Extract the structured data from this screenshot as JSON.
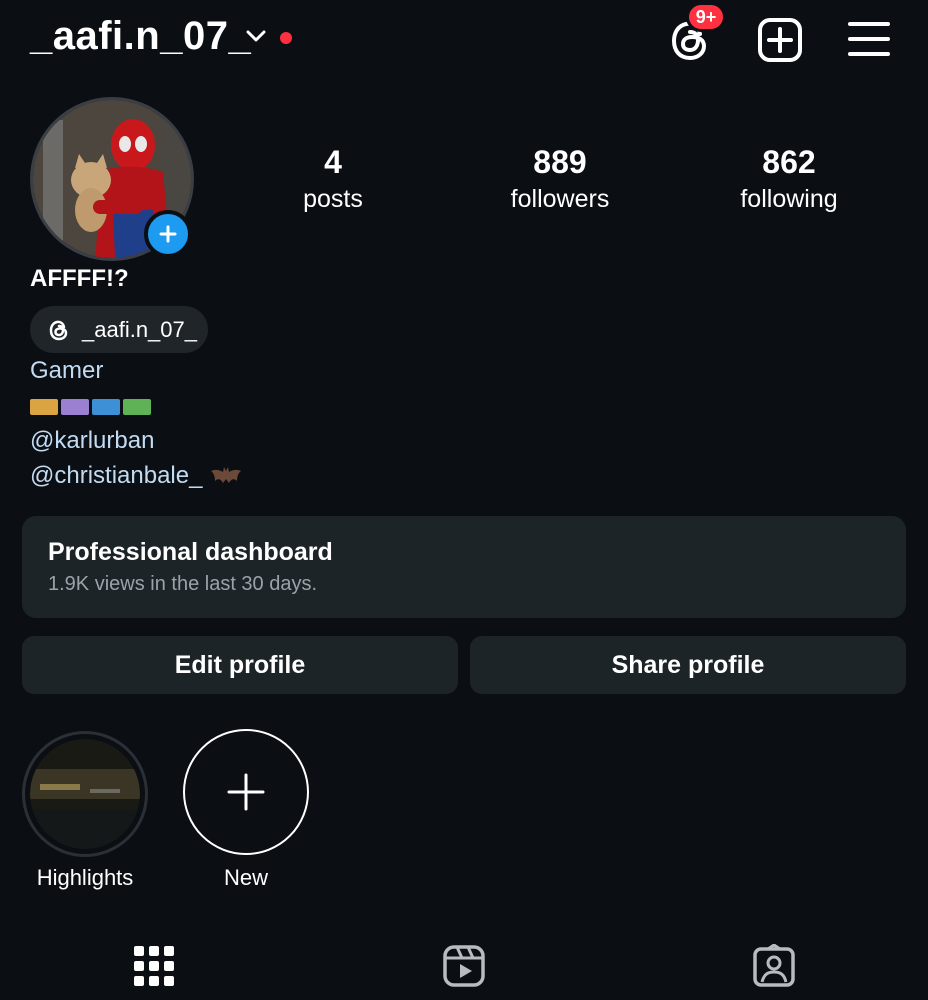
{
  "header": {
    "username": "_aafi.n_07_",
    "threads_badge": "9+",
    "icons": [
      "chevron-down-icon",
      "threads-icon",
      "new-post-icon",
      "hamburger-menu-icon"
    ]
  },
  "stats": [
    {
      "value": "4",
      "label": "posts"
    },
    {
      "value": "889",
      "label": "followers"
    },
    {
      "value": "862",
      "label": "following"
    }
  ],
  "profile": {
    "display_name": "AFFFF!?",
    "threads_handle": "_aafi.n_07_",
    "bio_category": "Gamer",
    "bio_mention_1": "@karlurban",
    "bio_mention_2": "@christianbale_"
  },
  "dashboard": {
    "title": "Professional dashboard",
    "subtitle": "1.9K views in the last 30 days."
  },
  "buttons": {
    "edit": "Edit profile",
    "share": "Share profile"
  },
  "highlights": [
    {
      "label": "Highlights"
    },
    {
      "label": "New"
    }
  ],
  "tabs": [
    "grid-icon",
    "reels-icon",
    "tagged-icon"
  ],
  "colors": {
    "background": "#0b0f14",
    "accent_blue": "#1d9bf0",
    "badge_red": "#ff3040",
    "link_blue": "#c2dbf2",
    "card": "#1c2428"
  }
}
